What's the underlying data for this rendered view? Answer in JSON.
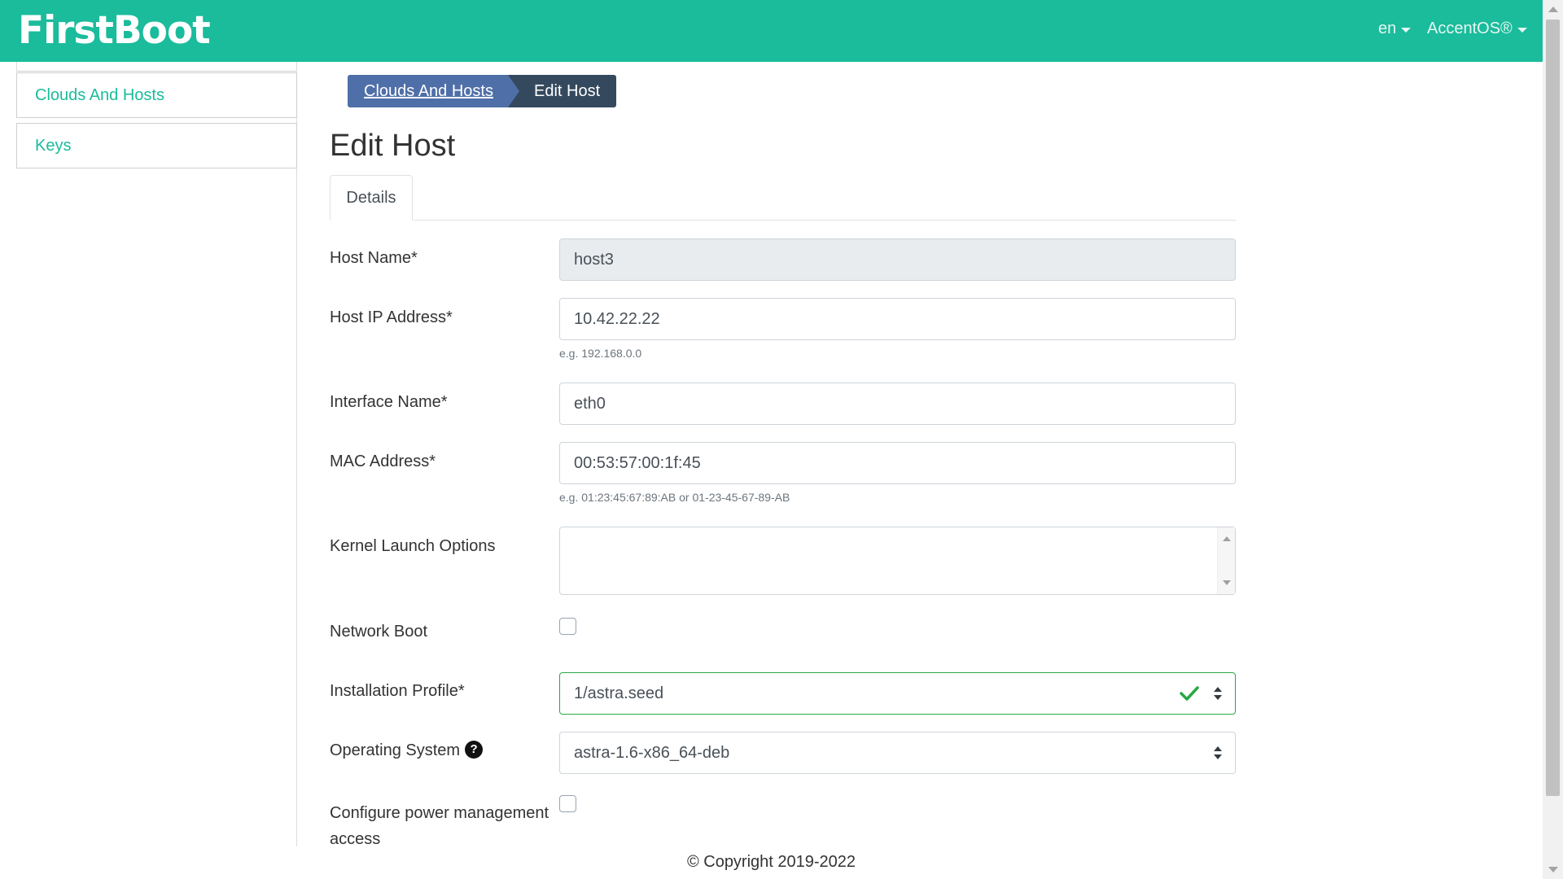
{
  "header": {
    "brand": "FirstBoot",
    "language": "en",
    "product": "AccentOS®",
    "bg_color": "#1abc9c"
  },
  "sidebar": {
    "items": [
      {
        "label": "Clouds And Hosts"
      },
      {
        "label": "Keys"
      }
    ]
  },
  "breadcrumb": {
    "parent": "Clouds And Hosts",
    "current": "Edit Host"
  },
  "page": {
    "title": "Edit Host",
    "tab": "Details"
  },
  "form": {
    "host_name": {
      "label": "Host Name*",
      "value": "host3"
    },
    "host_ip": {
      "label": "Host IP Address*",
      "value": "10.42.22.22",
      "help": "e.g. 192.168.0.0"
    },
    "interface_name": {
      "label": "Interface Name*",
      "value": "eth0"
    },
    "mac_address": {
      "label": "MAC Address*",
      "value": "00:53:57:00:1f:45",
      "help": "e.g. 01:23:45:67:89:AB or 01-23-45-67-89-AB"
    },
    "kernel_options": {
      "label": "Kernel Launch Options",
      "value": ""
    },
    "network_boot": {
      "label": "Network Boot",
      "checked": false
    },
    "installation_profile": {
      "label": "Installation Profile*",
      "value": "1/astra.seed"
    },
    "operating_system": {
      "label": "Operating System",
      "value": "astra-1.6-x86_64-deb",
      "help_icon": "?"
    },
    "power_management": {
      "label": "Configure power management access",
      "checked": false
    }
  },
  "footer": {
    "copyright": "© Copyright 2019-2022"
  },
  "colors": {
    "accent": "#1abc9c",
    "breadcrumb_parent": "#4f6fa8",
    "breadcrumb_current": "#34495e",
    "valid": "#28a745"
  }
}
